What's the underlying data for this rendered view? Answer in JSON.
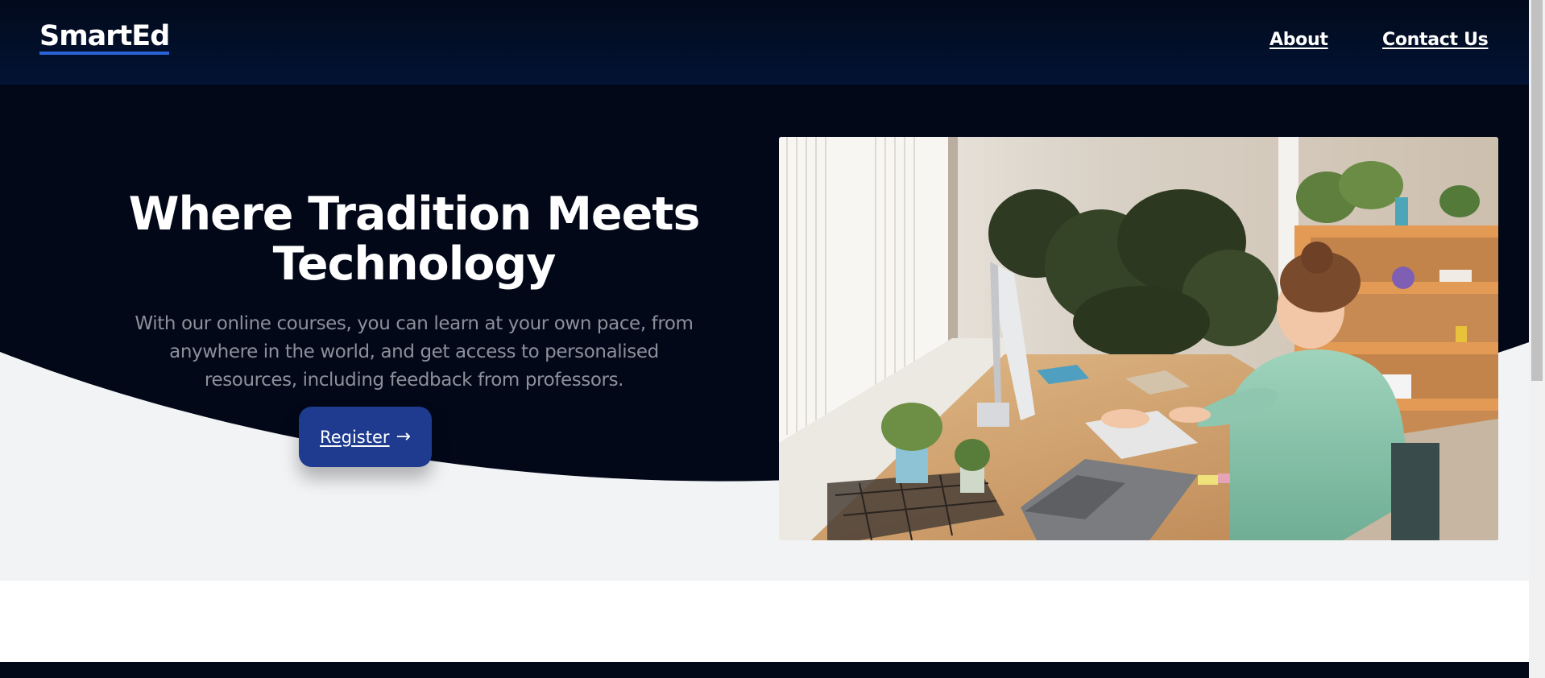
{
  "brand": {
    "logo": "SmartEd"
  },
  "nav": {
    "about": "About",
    "contact": "Contact Us"
  },
  "hero": {
    "title": "Where Tradition Meets Technology",
    "description": "With our online courses, you can learn at your own pace, from anywhere in the world, and get access to personalised resources, including feedback from professors.",
    "cta_label": "Register",
    "cta_icon": "arrow-right-icon"
  },
  "colors": {
    "navbar": "#031334",
    "hero_dark": "#020818",
    "hero_light": "#f2f3f5",
    "button": "#1e3b8f",
    "logo_underline": "#2b63d9",
    "text_muted": "#8b909a"
  }
}
